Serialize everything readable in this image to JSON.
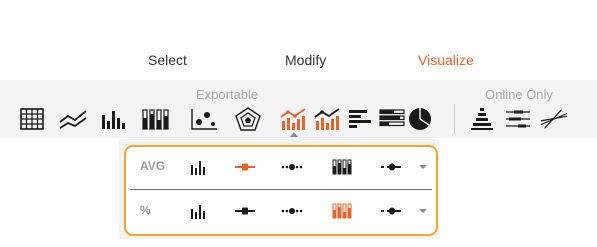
{
  "tabs": [
    {
      "label": "Select",
      "active": false
    },
    {
      "label": "Modify",
      "active": false
    },
    {
      "label": "Visualize",
      "active": true
    }
  ],
  "toolbar": {
    "group_exportable": "Exportable",
    "group_online": "Online Only",
    "tools": [
      "table-icon",
      "line-chart-icon",
      "bar-chart-icon",
      "stacked-bar-icon",
      "scatter-icon",
      "radar-icon",
      "combo-chart-icon",
      "horizontal-bar-icon",
      "stacked-horizontal-bar-icon",
      "pie-chart-icon",
      "pyramid-icon",
      "range-bars-icon",
      "crossing-lines-icon"
    ],
    "selected_tool": "combo-chart-icon"
  },
  "popup": {
    "rows": [
      {
        "label": "AVG",
        "selected_option": 2
      },
      {
        "label": "%",
        "selected_option": 5
      }
    ],
    "options": [
      "bars-icon",
      "line-marker-icon",
      "dots-icon",
      "stacked-bars-icon",
      "dash-marker-icon"
    ]
  },
  "colors": {
    "accent": "#e8632a",
    "highlight_border": "#f0a92c",
    "icon": "#1a1a1a",
    "toolbar_bg": "#f3f3f3"
  }
}
